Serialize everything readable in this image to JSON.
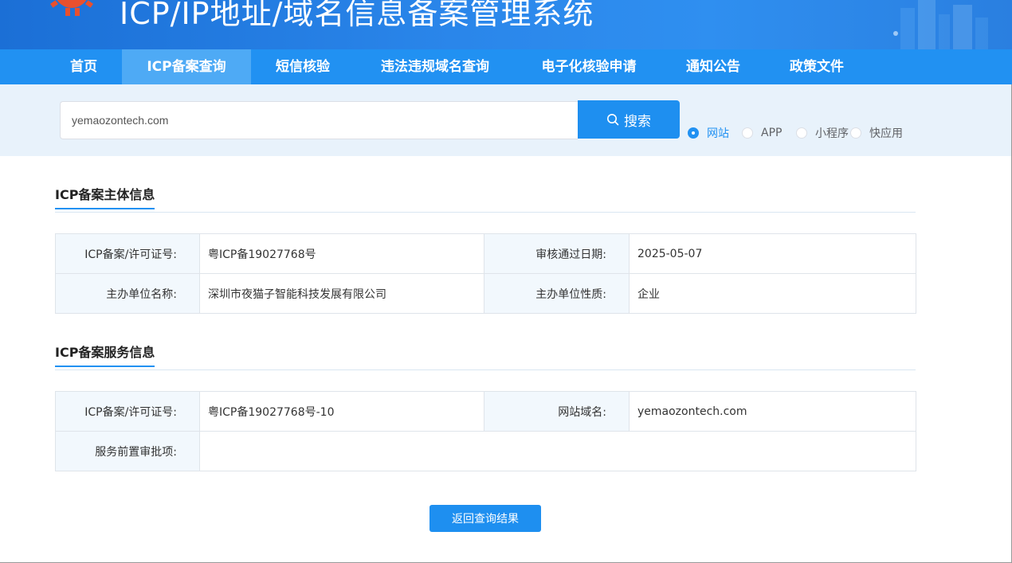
{
  "header": {
    "title": "ICP/IP地址/域名信息备案管理系统",
    "logo_icon": "gear-logo-icon",
    "brand_color": "#2191f2"
  },
  "nav": {
    "items": [
      {
        "label": "首页",
        "active": false
      },
      {
        "label": "ICP备案查询",
        "active": true
      },
      {
        "label": "短信核验",
        "active": false
      },
      {
        "label": "违法违规域名查询",
        "active": false
      },
      {
        "label": "电子化核验申请",
        "active": false
      },
      {
        "label": "通知公告",
        "active": false
      },
      {
        "label": "政策文件",
        "active": false
      }
    ]
  },
  "search": {
    "value": "yemaozontech.com",
    "button_label": "搜索",
    "button_icon": "search-icon",
    "types": [
      {
        "label": "网站",
        "checked": true
      },
      {
        "label": "APP",
        "checked": false
      },
      {
        "label": "小程序",
        "checked": false
      },
      {
        "label": "快应用",
        "checked": false
      }
    ]
  },
  "subject_info": {
    "title": "ICP备案主体信息",
    "rows": [
      [
        {
          "label": "ICP备案/许可证号:",
          "value": "粤ICP备19027768号"
        },
        {
          "label": "审核通过日期:",
          "value": "2025-05-07"
        }
      ],
      [
        {
          "label": "主办单位名称:",
          "value": "深圳市夜猫子智能科技发展有限公司"
        },
        {
          "label": "主办单位性质:",
          "value": "企业"
        }
      ]
    ]
  },
  "service_info": {
    "title": "ICP备案服务信息",
    "license_label": "ICP备案/许可证号:",
    "license_value": "粤ICP备19027768号-10",
    "domain_label": "网站域名:",
    "domain_value": "yemaozontech.com",
    "approval_label": "服务前置审批项:",
    "approval_value": ""
  },
  "actions": {
    "back_label": "返回查询结果"
  }
}
